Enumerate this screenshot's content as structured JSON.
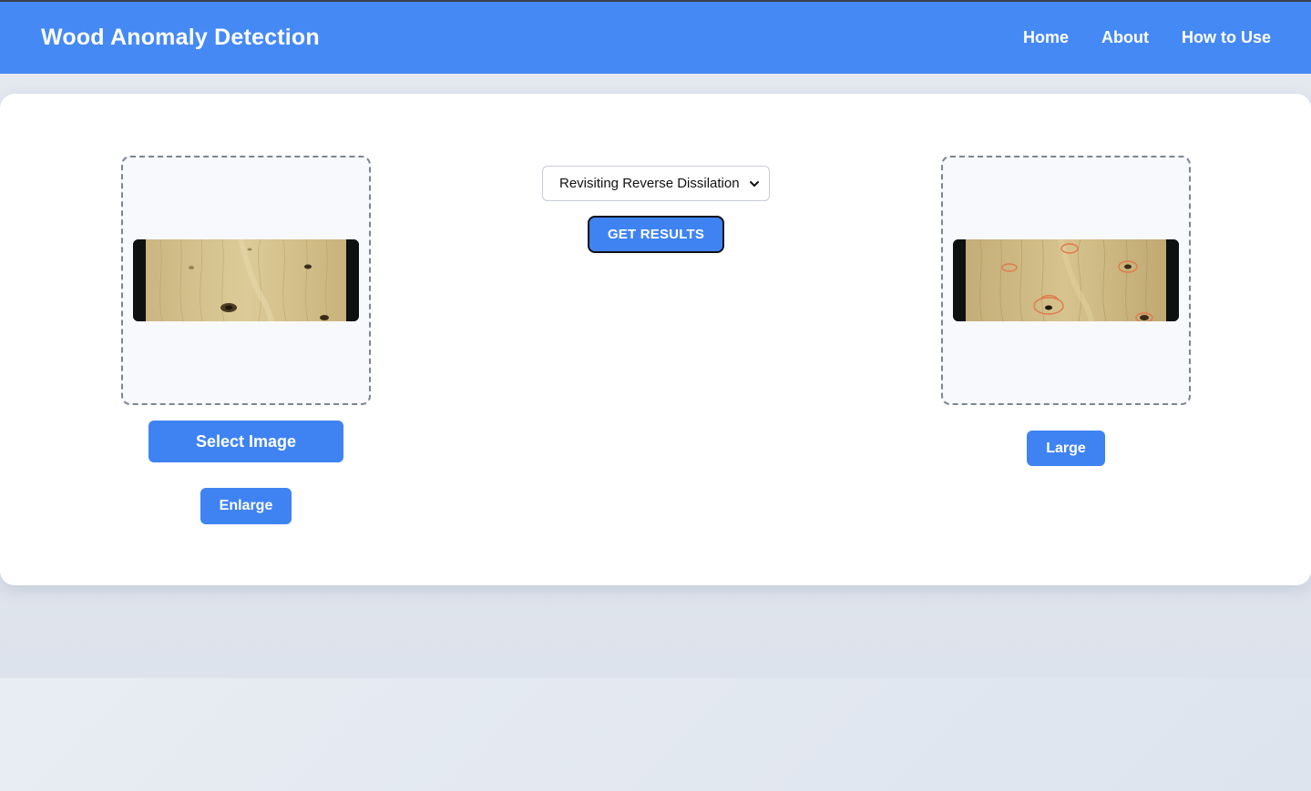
{
  "navbar": {
    "brand": "Wood Anomaly Detection",
    "links": [
      "Home",
      "About",
      "How to Use"
    ]
  },
  "controls": {
    "model_select": {
      "selected": "Revisiting Reverse Dissilation"
    },
    "get_results_label": "GET RESULTS"
  },
  "input_panel": {
    "select_image_label": "Select Image",
    "enlarge_label": "Enlarge"
  },
  "output_panel": {
    "large_label": "Large"
  },
  "colors": {
    "primary": "#3f83f3",
    "navbar": "#4589f5",
    "anomaly_outline": "#e07a4a"
  },
  "icons": {
    "select_chevron": "chevron-down-icon"
  }
}
